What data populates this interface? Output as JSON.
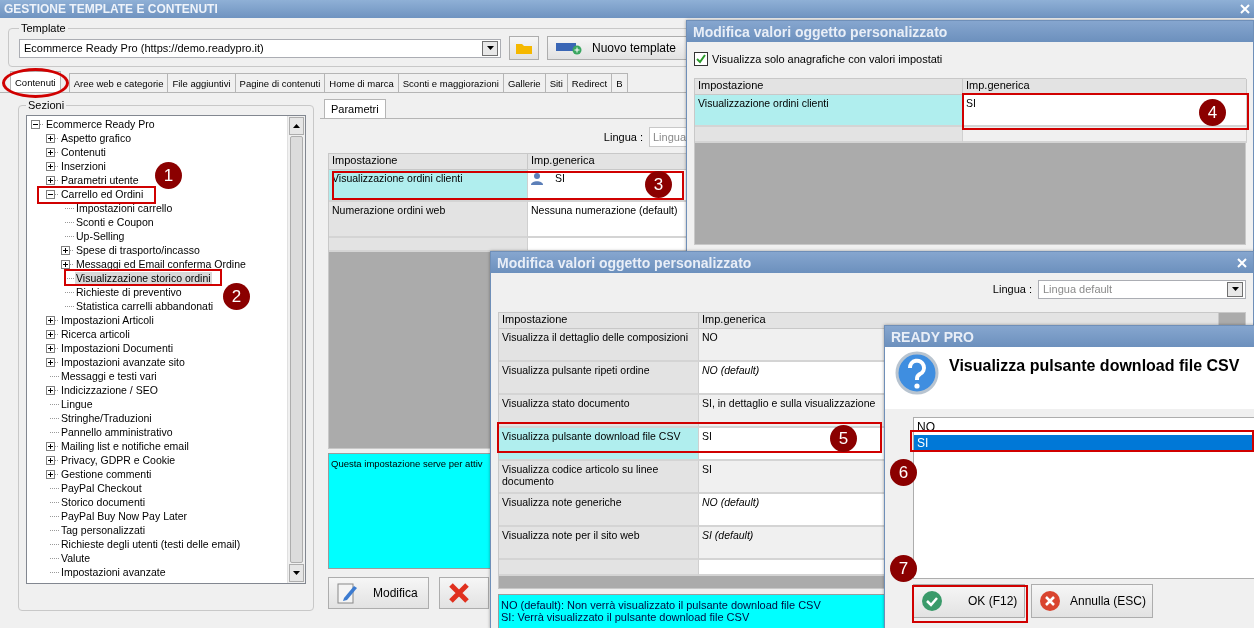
{
  "main_window": {
    "title": "GESTIONE TEMPLATE E CONTENUTI",
    "template": {
      "legend": "Template",
      "value": "Ecommerce Ready Pro (https://demo.readypro.it)",
      "new_button": "Nuovo template"
    },
    "tabs": [
      {
        "label": "Contenuti",
        "selected": true
      },
      {
        "label": "Aree web e categorie",
        "selected": false
      },
      {
        "label": "File aggiuntivi",
        "selected": false
      },
      {
        "label": "Pagine di contenuti",
        "selected": false
      },
      {
        "label": "Home di marca",
        "selected": false
      },
      {
        "label": "Sconti e maggiorazioni",
        "selected": false
      },
      {
        "label": "Gallerie",
        "selected": false
      },
      {
        "label": "Siti",
        "selected": false
      },
      {
        "label": "Redirect",
        "selected": false
      },
      {
        "label": "B",
        "selected": false
      }
    ],
    "sections": {
      "legend": "Sezioni",
      "tree": [
        {
          "label": "Ecommerce Ready Pro",
          "kind": "node",
          "expanded": true,
          "selected": false,
          "children": [
            {
              "label": "Aspetto grafico",
              "kind": "node",
              "expanded": false,
              "selected": false
            },
            {
              "label": "Contenuti",
              "kind": "node",
              "expanded": false,
              "selected": false
            },
            {
              "label": "Inserzioni",
              "kind": "node",
              "expanded": false,
              "selected": false
            },
            {
              "label": "Parametri utente",
              "kind": "node",
              "expanded": false,
              "selected": false
            },
            {
              "label": "Carrello ed Ordini",
              "kind": "node",
              "expanded": true,
              "selected": false,
              "children": [
                {
                  "label": "Impostazioni carrello",
                  "kind": "leaf",
                  "selected": false
                },
                {
                  "label": "Sconti e Coupon",
                  "kind": "leaf",
                  "selected": false
                },
                {
                  "label": "Up-Selling",
                  "kind": "leaf",
                  "selected": false
                },
                {
                  "label": "Spese di trasporto/incasso",
                  "kind": "node",
                  "expanded": false,
                  "selected": false
                },
                {
                  "label": "Messaggi ed Email conferma Ordine",
                  "kind": "node",
                  "expanded": false,
                  "selected": false
                },
                {
                  "label": "Visualizzazione storico ordini",
                  "kind": "leaf",
                  "selected": true
                },
                {
                  "label": "Richieste di preventivo",
                  "kind": "leaf",
                  "selected": false
                },
                {
                  "label": "Statistica carrelli abbandonati",
                  "kind": "leaf",
                  "selected": false
                }
              ]
            },
            {
              "label": "Impostazioni Articoli",
              "kind": "node",
              "expanded": false,
              "selected": false
            },
            {
              "label": "Ricerca articoli",
              "kind": "node",
              "expanded": false,
              "selected": false
            },
            {
              "label": "Impostazioni Documenti",
              "kind": "node",
              "expanded": false,
              "selected": false
            },
            {
              "label": "Impostazioni avanzate sito",
              "kind": "node",
              "expanded": false,
              "selected": false
            },
            {
              "label": "Messaggi e testi vari",
              "kind": "leaf",
              "selected": false
            },
            {
              "label": "Indicizzazione / SEO",
              "kind": "node",
              "expanded": false,
              "selected": false
            },
            {
              "label": "Lingue",
              "kind": "leaf",
              "selected": false
            },
            {
              "label": "Stringhe/Traduzioni",
              "kind": "leaf",
              "selected": false
            },
            {
              "label": "Pannello amministrativo",
              "kind": "leaf",
              "selected": false
            },
            {
              "label": "Mailing list e notifiche email",
              "kind": "node",
              "expanded": false,
              "selected": false
            },
            {
              "label": "Privacy, GDPR e Cookie",
              "kind": "node",
              "expanded": false,
              "selected": false
            },
            {
              "label": "Gestione commenti",
              "kind": "node",
              "expanded": false,
              "selected": false
            },
            {
              "label": "PayPal Checkout",
              "kind": "leaf",
              "selected": false
            },
            {
              "label": "Storico documenti",
              "kind": "leaf",
              "selected": false
            },
            {
              "label": "PayPal Buy Now Pay Later",
              "kind": "leaf",
              "selected": false
            },
            {
              "label": "Tag personalizzati",
              "kind": "leaf",
              "selected": false
            },
            {
              "label": "Richieste degli utenti (testi delle email)",
              "kind": "leaf",
              "selected": false
            },
            {
              "label": "Valute",
              "kind": "leaf",
              "selected": false
            },
            {
              "label": "Impostazioni avanzate",
              "kind": "leaf",
              "selected": false
            }
          ]
        }
      ]
    },
    "panel": {
      "tab": "Parametri",
      "language_label": "Lingua :",
      "language_value": "Lingua",
      "columns": [
        "Impostazione",
        "Imp.generica"
      ],
      "rows": [
        {
          "setting": "Visualizzazione ordini clienti",
          "value": "SI",
          "selected": true,
          "user_icon": true
        },
        {
          "setting": "Numerazione ordini web",
          "value": "Nessuna numerazione (default)",
          "selected": false,
          "user_icon": false
        }
      ],
      "description": "Questa impostazione serve per attiv",
      "edit_button": "Modifica"
    }
  },
  "dialog_filtered": {
    "title": "Modifica valori oggetto personalizzato",
    "checkbox": {
      "label": "Visualizza solo anagrafiche con valori impostati",
      "checked": true
    },
    "columns": [
      "Impostazione",
      "Imp.generica"
    ],
    "rows": [
      {
        "setting": "Visualizzazione ordini clienti",
        "value": "SI",
        "selected": true
      }
    ]
  },
  "dialog_values": {
    "title": "Modifica valori oggetto personalizzato",
    "language_label": "Lingua :",
    "language_value": "Lingua default",
    "columns": [
      "Impostazione",
      "Imp.generica"
    ],
    "rows": [
      {
        "setting": "Visualizza il dettaglio delle composizioni",
        "value": "NO",
        "is_default": false,
        "selected": false
      },
      {
        "setting": "Visualizza pulsante ripeti ordine",
        "value": "NO (default)",
        "is_default": true,
        "selected": false
      },
      {
        "setting": "Visualizza stato documento",
        "value": "SI, in dettaglio e sulla visualizzazione",
        "is_default": false,
        "selected": false
      },
      {
        "setting": "Visualizza pulsante download file CSV",
        "value": "SI",
        "is_default": false,
        "selected": true
      },
      {
        "setting": "Visualizza codice articolo su linee documento",
        "value": "SI",
        "is_default": false,
        "selected": false
      },
      {
        "setting": "Visualizza note generiche",
        "value": "NO (default)",
        "is_default": true,
        "selected": false
      },
      {
        "setting": "Visualizza note per il sito web",
        "value": "SI (default)",
        "is_default": true,
        "selected": false
      }
    ],
    "description": [
      "NO (default): Non verrà visualizzato il pulsante download file CSV",
      "SI: Verrà visualizzato il pulsante download file CSV"
    ]
  },
  "dialog_choice": {
    "title": "READY PRO",
    "question": "Visualizza pulsante download file CSV",
    "options": [
      {
        "label": "NO",
        "selected": false
      },
      {
        "label": "SI",
        "selected": true
      }
    ],
    "ok_button": "OK (F12)",
    "cancel_button": "Annulla (ESC)"
  },
  "annotations": [
    "1",
    "2",
    "3",
    "4",
    "5",
    "6",
    "7"
  ]
}
